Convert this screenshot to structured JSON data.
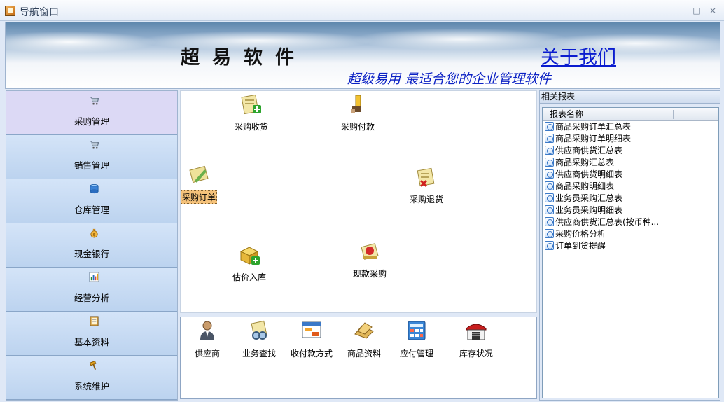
{
  "window": {
    "title": "导航窗口",
    "minimize_glyph": "–",
    "maximize_glyph": "□",
    "close_glyph": "×"
  },
  "banner": {
    "brand": "超易软件",
    "about_link": "关于我们",
    "slogan": "超级易用 最适合您的企业管理软件"
  },
  "nav": {
    "items": [
      {
        "label": "采购管理",
        "icon": "cart-icon",
        "active": true
      },
      {
        "label": "销售管理",
        "icon": "cart-icon"
      },
      {
        "label": "仓库管理",
        "icon": "warehouse-icon"
      },
      {
        "label": "现金银行",
        "icon": "money-bag-icon"
      },
      {
        "label": "经营分析",
        "icon": "chart-icon"
      },
      {
        "label": "基本资料",
        "icon": "folder-icon"
      },
      {
        "label": "系统维护",
        "icon": "hammer-icon"
      }
    ]
  },
  "flow": {
    "receive": "采购收货",
    "pay": "采购付款",
    "order": "采购订单",
    "return": "采购退货",
    "estimate": "估价入库",
    "cash_purchase": "现款采购"
  },
  "toolbar": {
    "supplier": "供应商",
    "business_query": "业务查找",
    "payment_method": "收付款方式",
    "goods_info": "商品资料",
    "payables": "应付管理",
    "stock_status": "库存状况"
  },
  "reports": {
    "header": "相关报表",
    "column": "报表名称",
    "items": [
      "商品采购订单汇总表",
      "商品采购订单明细表",
      "供应商供货汇总表",
      "商品采购汇总表",
      "供应商供货明细表",
      "商品采购明细表",
      "业务员采购汇总表",
      "业务员采购明细表",
      "供应商供货汇总表(按币种...",
      "采购价格分析",
      "订单到货提醒"
    ]
  },
  "colors": {
    "link_blue": "#0a1ccf",
    "slogan_blue": "#0b21c4",
    "nav_active": "#dcd9f5",
    "selected_label": "#f5c27a"
  }
}
